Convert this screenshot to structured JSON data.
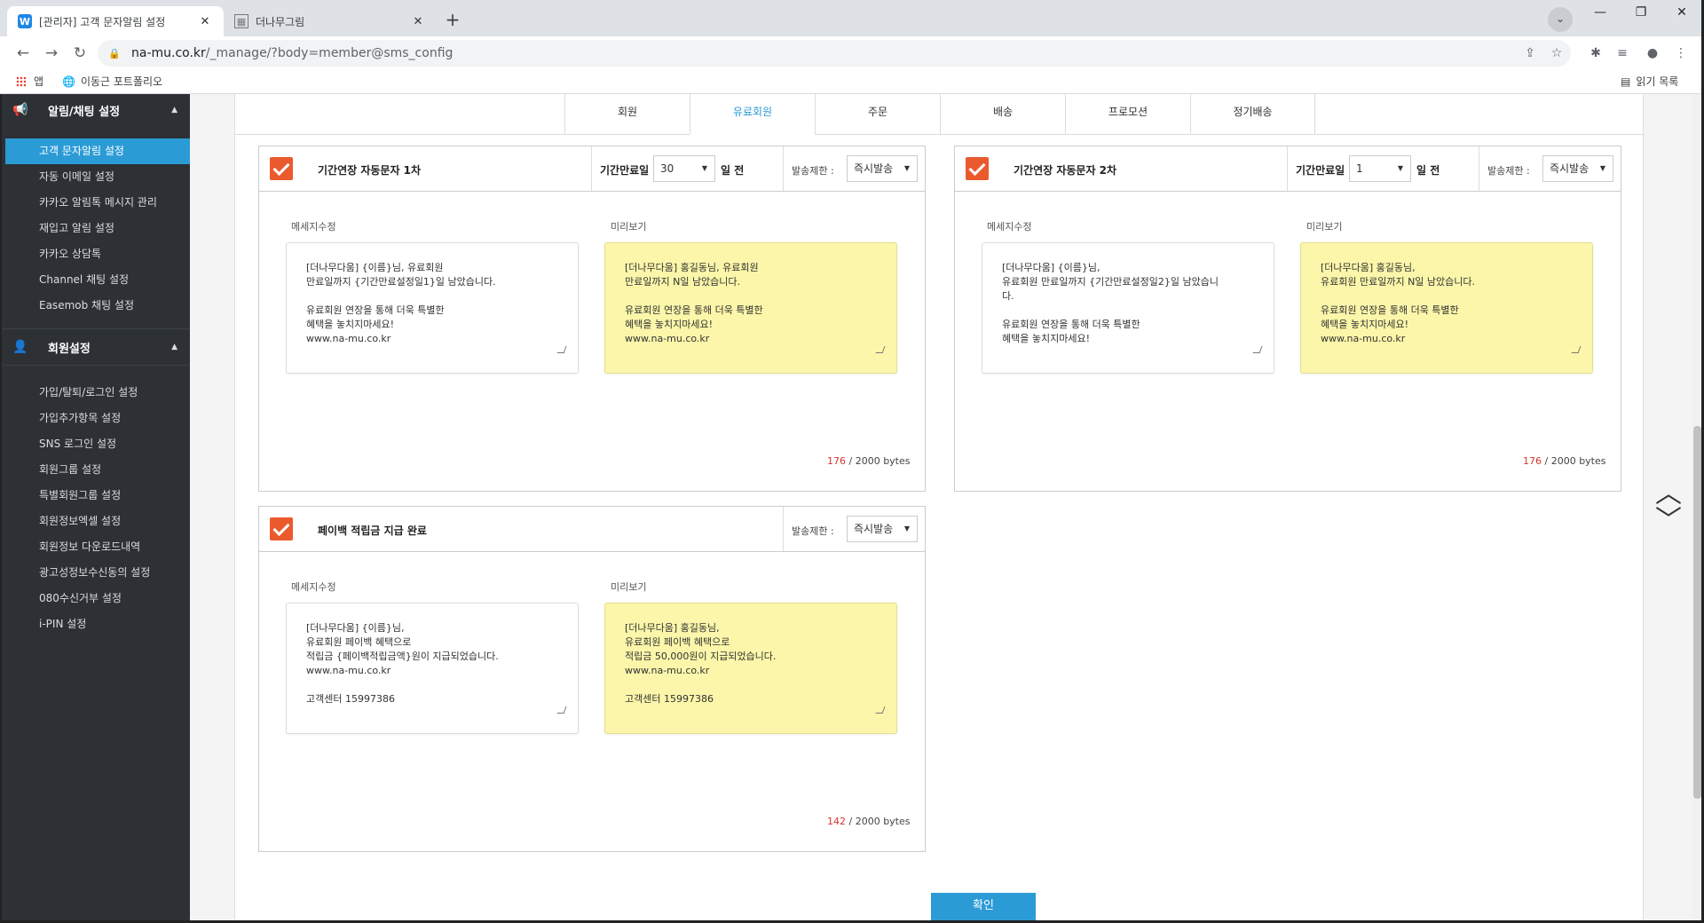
{
  "browser": {
    "tabs": [
      {
        "favicon": "W",
        "title": "[관리자] 고객 문자알림 설정",
        "active": true
      },
      {
        "favicon": "grid",
        "title": "더나무그림",
        "active": false
      }
    ],
    "url_domain": "na-mu.co.kr",
    "url_path": "/_manage/?body=member@sms_config",
    "bookmarks": [
      {
        "icon": "apps-icon",
        "label": "앱"
      },
      {
        "icon": "globe-icon",
        "label": "이동근 포트폴리오"
      }
    ],
    "reading_list": "읽기 목록"
  },
  "sidebar": {
    "section1": {
      "title": "알림/채팅 설정",
      "items": [
        {
          "label": "고객 문자알림 설정",
          "active": true
        },
        {
          "label": "자동 이메일 설정"
        },
        {
          "label": "카카오 알림톡 메시지 관리"
        },
        {
          "label": "재입고 알림 설정"
        },
        {
          "label": "카카오 상담톡"
        },
        {
          "label": "Channel 채팅 설정"
        },
        {
          "label": "Easemob 채팅 설정"
        }
      ]
    },
    "section2": {
      "title": "회원설정",
      "items": [
        {
          "label": "가입/탈퇴/로그인 설정"
        },
        {
          "label": "가입추가항목 설정"
        },
        {
          "label": "SNS 로그인 설정"
        },
        {
          "label": "회원그룹 설정"
        },
        {
          "label": "특별회원그룹 설정"
        },
        {
          "label": "회원정보엑셀 설정"
        },
        {
          "label": "회원정보 다운로드내역"
        },
        {
          "label": "광고성정보수신동의 설정"
        },
        {
          "label": "080수신거부 설정"
        },
        {
          "label": "i-PIN 설정"
        }
      ]
    }
  },
  "tabs": [
    "회원",
    "유료회원",
    "주문",
    "배송",
    "프로모션",
    "정기배송"
  ],
  "active_tab": "유료회원",
  "labels": {
    "period": "기간만료일",
    "days_before": "일 전",
    "limit": "발송제한 :",
    "edit": "메세지수정",
    "preview": "미리보기",
    "bytes_suffix": "/ 2000 bytes",
    "confirm": "확인"
  },
  "panels": [
    {
      "checked": true,
      "title": "기간연장 자동문자 1차",
      "period_value": "30",
      "limit_value": "즉시발송",
      "edit_lines": [
        "[더나무다움] {이름}님, 유료회원",
        "만료일까지 {기간만료설정일1}일 남았습니다.",
        "",
        "유료회원 연장을 통해 더욱 특별한",
        "혜택을 놓치지마세요!",
        "www.na-mu.co.kr"
      ],
      "preview_lines": [
        "[더나무다움] 홍길동님, 유료회원",
        "만료일까지 N일 남았습니다.",
        "",
        "유료회원 연장을 통해 더욱 특별한",
        "혜택을 놓치지마세요!",
        "www.na-mu.co.kr"
      ],
      "bytes_used": "176"
    },
    {
      "checked": true,
      "title": "기간연장 자동문자 2차",
      "period_value": "1",
      "limit_value": "즉시발송",
      "edit_lines": [
        "[더나무다움] {이름}님,",
        "유료회원 만료일까지 {기간만료설정일2}일 남았습니",
        "다.",
        "",
        "유료회원 연장을 통해 더욱 특별한",
        "혜택을 놓치지마세요!"
      ],
      "preview_lines": [
        "[더나무다움] 홍길동님,",
        "유료회원 만료일까지 N일 남았습니다.",
        "",
        "유료회원 연장을 통해 더욱 특별한",
        "혜택을 놓치지마세요!",
        "www.na-mu.co.kr"
      ],
      "bytes_used": "176"
    },
    {
      "checked": true,
      "title": "페이백 적립금 지급 완료",
      "limit_value": "즉시발송",
      "edit_lines": [
        "[더나무다움] {이름}님,",
        "유료회원 페이백 혜택으로",
        "적립금 {페이백적립금액}원이 지급되었습니다.",
        "www.na-mu.co.kr",
        "",
        "고객센터 15997386"
      ],
      "preview_lines": [
        "[더나무다움] 홍길동님,",
        "유료회원 페이백 혜택으로",
        "적립금 50,000원이 지급되었습니다.",
        "www.na-mu.co.kr",
        "",
        "고객센터 15997386"
      ],
      "bytes_used": "142"
    }
  ],
  "colors": {
    "accent": "#2b9bd6",
    "checkbox": "#ea5a2d",
    "preview_bg": "#fbf6a9",
    "sidebar_bg": "#2d3136",
    "bytes_used": "#d9342b"
  }
}
